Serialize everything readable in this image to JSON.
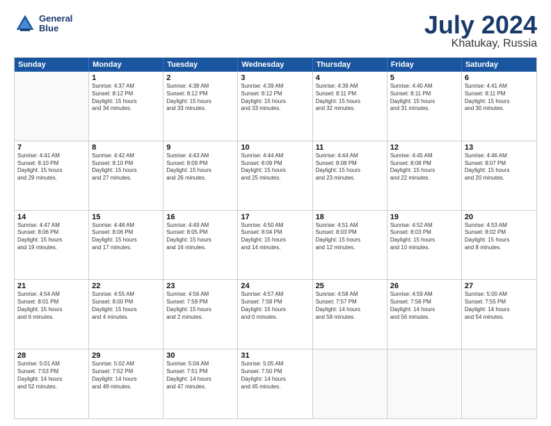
{
  "header": {
    "logo_line1": "General",
    "logo_line2": "Blue",
    "title": "July 2024",
    "subtitle": "Khatukay, Russia"
  },
  "weekdays": [
    "Sunday",
    "Monday",
    "Tuesday",
    "Wednesday",
    "Thursday",
    "Friday",
    "Saturday"
  ],
  "rows": [
    [
      {
        "day": "",
        "info": ""
      },
      {
        "day": "1",
        "info": "Sunrise: 4:37 AM\nSunset: 8:12 PM\nDaylight: 15 hours\nand 34 minutes."
      },
      {
        "day": "2",
        "info": "Sunrise: 4:38 AM\nSunset: 8:12 PM\nDaylight: 15 hours\nand 33 minutes."
      },
      {
        "day": "3",
        "info": "Sunrise: 4:39 AM\nSunset: 8:12 PM\nDaylight: 15 hours\nand 33 minutes."
      },
      {
        "day": "4",
        "info": "Sunrise: 4:39 AM\nSunset: 8:11 PM\nDaylight: 15 hours\nand 32 minutes."
      },
      {
        "day": "5",
        "info": "Sunrise: 4:40 AM\nSunset: 8:11 PM\nDaylight: 15 hours\nand 31 minutes."
      },
      {
        "day": "6",
        "info": "Sunrise: 4:41 AM\nSunset: 8:11 PM\nDaylight: 15 hours\nand 30 minutes."
      }
    ],
    [
      {
        "day": "7",
        "info": "Sunrise: 4:41 AM\nSunset: 8:10 PM\nDaylight: 15 hours\nand 29 minutes."
      },
      {
        "day": "8",
        "info": "Sunrise: 4:42 AM\nSunset: 8:10 PM\nDaylight: 15 hours\nand 27 minutes."
      },
      {
        "day": "9",
        "info": "Sunrise: 4:43 AM\nSunset: 8:09 PM\nDaylight: 15 hours\nand 26 minutes."
      },
      {
        "day": "10",
        "info": "Sunrise: 4:44 AM\nSunset: 8:09 PM\nDaylight: 15 hours\nand 25 minutes."
      },
      {
        "day": "11",
        "info": "Sunrise: 4:44 AM\nSunset: 8:08 PM\nDaylight: 15 hours\nand 23 minutes."
      },
      {
        "day": "12",
        "info": "Sunrise: 4:45 AM\nSunset: 8:08 PM\nDaylight: 15 hours\nand 22 minutes."
      },
      {
        "day": "13",
        "info": "Sunrise: 4:46 AM\nSunset: 8:07 PM\nDaylight: 15 hours\nand 20 minutes."
      }
    ],
    [
      {
        "day": "14",
        "info": "Sunrise: 4:47 AM\nSunset: 8:06 PM\nDaylight: 15 hours\nand 19 minutes."
      },
      {
        "day": "15",
        "info": "Sunrise: 4:48 AM\nSunset: 8:06 PM\nDaylight: 15 hours\nand 17 minutes."
      },
      {
        "day": "16",
        "info": "Sunrise: 4:49 AM\nSunset: 8:05 PM\nDaylight: 15 hours\nand 16 minutes."
      },
      {
        "day": "17",
        "info": "Sunrise: 4:50 AM\nSunset: 8:04 PM\nDaylight: 15 hours\nand 14 minutes."
      },
      {
        "day": "18",
        "info": "Sunrise: 4:51 AM\nSunset: 8:03 PM\nDaylight: 15 hours\nand 12 minutes."
      },
      {
        "day": "19",
        "info": "Sunrise: 4:52 AM\nSunset: 8:03 PM\nDaylight: 15 hours\nand 10 minutes."
      },
      {
        "day": "20",
        "info": "Sunrise: 4:53 AM\nSunset: 8:02 PM\nDaylight: 15 hours\nand 8 minutes."
      }
    ],
    [
      {
        "day": "21",
        "info": "Sunrise: 4:54 AM\nSunset: 8:01 PM\nDaylight: 15 hours\nand 6 minutes."
      },
      {
        "day": "22",
        "info": "Sunrise: 4:55 AM\nSunset: 8:00 PM\nDaylight: 15 hours\nand 4 minutes."
      },
      {
        "day": "23",
        "info": "Sunrise: 4:56 AM\nSunset: 7:59 PM\nDaylight: 15 hours\nand 2 minutes."
      },
      {
        "day": "24",
        "info": "Sunrise: 4:57 AM\nSunset: 7:58 PM\nDaylight: 15 hours\nand 0 minutes."
      },
      {
        "day": "25",
        "info": "Sunrise: 4:58 AM\nSunset: 7:57 PM\nDaylight: 14 hours\nand 58 minutes."
      },
      {
        "day": "26",
        "info": "Sunrise: 4:59 AM\nSunset: 7:56 PM\nDaylight: 14 hours\nand 56 minutes."
      },
      {
        "day": "27",
        "info": "Sunrise: 5:00 AM\nSunset: 7:55 PM\nDaylight: 14 hours\nand 54 minutes."
      }
    ],
    [
      {
        "day": "28",
        "info": "Sunrise: 5:01 AM\nSunset: 7:53 PM\nDaylight: 14 hours\nand 52 minutes."
      },
      {
        "day": "29",
        "info": "Sunrise: 5:02 AM\nSunset: 7:52 PM\nDaylight: 14 hours\nand 49 minutes."
      },
      {
        "day": "30",
        "info": "Sunrise: 5:04 AM\nSunset: 7:51 PM\nDaylight: 14 hours\nand 47 minutes."
      },
      {
        "day": "31",
        "info": "Sunrise: 5:05 AM\nSunset: 7:50 PM\nDaylight: 14 hours\nand 45 minutes."
      },
      {
        "day": "",
        "info": ""
      },
      {
        "day": "",
        "info": ""
      },
      {
        "day": "",
        "info": ""
      }
    ]
  ]
}
